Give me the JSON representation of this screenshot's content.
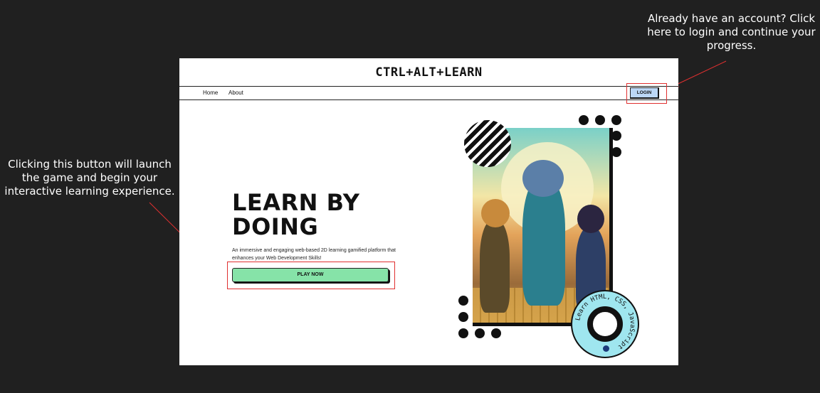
{
  "annotations": {
    "login_hint": "Already have an account? Click here to login and continue your progress.",
    "play_hint": "Clicking this button will launch the game and begin your interactive learning experience."
  },
  "header": {
    "brand": "CTRL+ALT+LEARN"
  },
  "nav": {
    "items": [
      {
        "label": "Home"
      },
      {
        "label": "About"
      }
    ],
    "login_label": "LOGIN"
  },
  "hero": {
    "title": "LEARN BY DOING",
    "description": "An immersive and engaging web-based 2D learning gamified platform that enhances your Web Development Skills!",
    "play_label": "PLAY NOW"
  },
  "badge": {
    "text": "Learn HTML, CSS, JavaScript"
  },
  "colors": {
    "page_background": "#202020",
    "login_button": "#bcd7f5",
    "play_button": "#86e3a8",
    "badge": "#9fe6ef",
    "annotation_box": "#e03030"
  },
  "icons": [
    "swirl-graphic",
    "dot-decoration",
    "illustration-kids"
  ]
}
